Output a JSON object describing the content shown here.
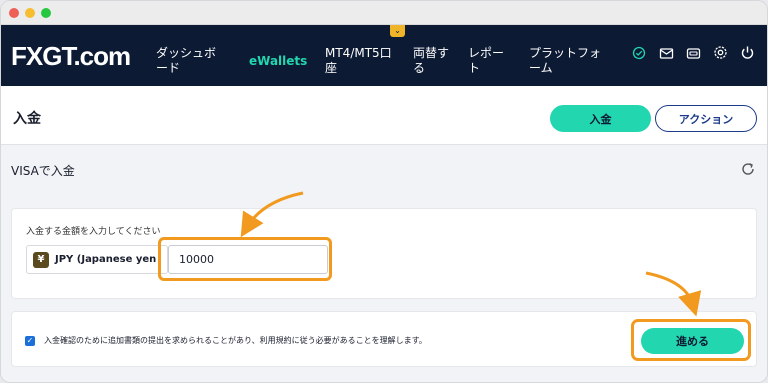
{
  "window": {
    "controls": [
      "close",
      "minimize",
      "maximize"
    ]
  },
  "nav": {
    "logo": "FXGT.com",
    "items": [
      {
        "label": "ダッシュボ\nード",
        "active": false
      },
      {
        "label": "eWallets",
        "active": true
      },
      {
        "label": "MT4/MT5口\n座",
        "active": false
      },
      {
        "label": "両替す\nる",
        "active": false
      },
      {
        "label": "レポー\nト",
        "active": false
      },
      {
        "label": "プラットフォ\nーム",
        "active": false
      }
    ],
    "tab_indicator": "⌄",
    "icons": [
      "verified-icon",
      "mail-icon",
      "wallet-icon",
      "settings-icon",
      "power-icon"
    ]
  },
  "header": {
    "title": "入金",
    "deposit_button": "入金",
    "action_button": "アクション"
  },
  "method": {
    "label": "VISAで入金"
  },
  "amount": {
    "label": "入金する金額を入力してください",
    "currency_symbol": "¥",
    "currency_text": "JPY (Japanese yen",
    "value": "10000"
  },
  "confirm": {
    "checked": true,
    "text": "入金確認のために追加書類の提出を求められることがあり、利用規約に従う必要があることを理解します。",
    "proceed_button": "進める"
  },
  "colors": {
    "accent": "#22d6b0",
    "navbar": "#0d1a33",
    "highlight": "#f19a1f",
    "action_border": "#1b3a8a"
  }
}
